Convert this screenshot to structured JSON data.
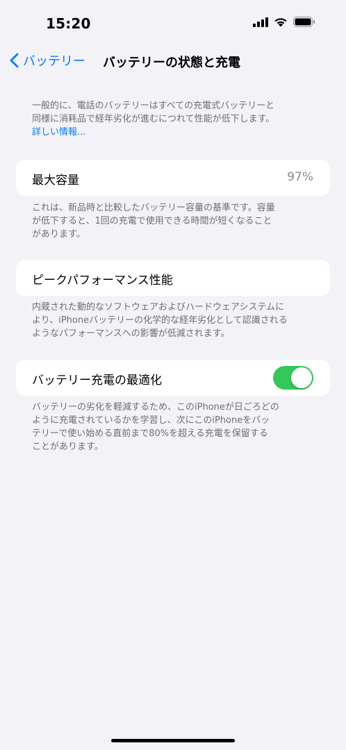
{
  "status_bar": {
    "time": "15:20",
    "icons": [
      "cellular-signal-icon",
      "wifi-icon",
      "battery-icon"
    ]
  },
  "nav": {
    "back_label": "バッテリー",
    "title": "バッテリーの状態と充電"
  },
  "intro": {
    "line1": "一般的に、電話のバッテリーはすべての充電式バッテリーと",
    "line2": "同様に消耗品で経年劣化が進むにつれて性能が低下します。",
    "link": "詳しい情報..."
  },
  "max_capacity": {
    "label": "最大容量",
    "value": "97%",
    "desc_line1": "これは、新品時と比較したバッテリー容量の基準です。容量",
    "desc_line2": "が低下すると、1回の充電で使用できる時間が短くなること",
    "desc_line3": "があります。"
  },
  "peak_performance": {
    "label": "ピークパフォーマンス性能",
    "desc_line1": "内蔵された動的なソフトウェアおよびハードウェアシステムに",
    "desc_line2": "より、iPhoneバッテリーの化学的な経年劣化として認識される",
    "desc_line3": "ようなパフォーマンスへの影響が低減されます。"
  },
  "optimized_charging": {
    "label": "バッテリー充電の最適化",
    "enabled": true,
    "desc_line1": "バッテリーの劣化を軽減するため、このiPhoneが日ごろどの",
    "desc_line2": "ように充電されているかを学習し、次にこのiPhoneをバッ",
    "desc_line3": "テリーで使い始める直前まで80%を超える充電を保留する",
    "desc_line4": "ことがあります。"
  },
  "colors": {
    "accent": "#007aff",
    "toggle_on": "#34c759",
    "background": "#f2f2f7",
    "secondary_text": "#6d6d72"
  }
}
